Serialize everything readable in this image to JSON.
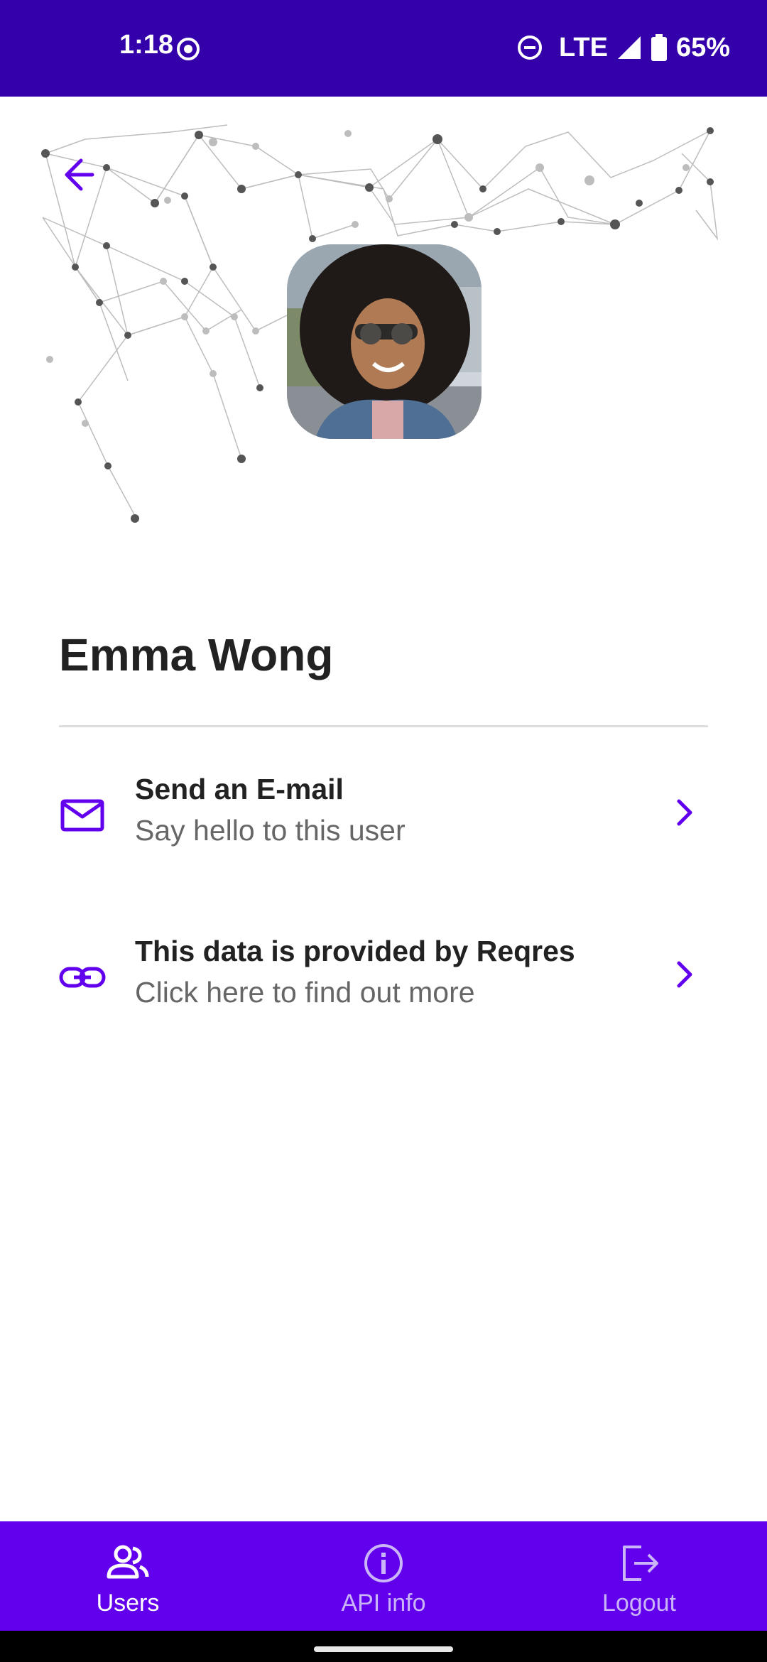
{
  "status_bar": {
    "time": "1:18",
    "network": "LTE",
    "battery": "65%"
  },
  "profile": {
    "name": "Emma Wong",
    "avatar_description": "photo"
  },
  "actions": [
    {
      "title": "Send an E-mail",
      "subtitle": "Say hello to this user",
      "icon": "mail-icon"
    },
    {
      "title": "This data is provided by Reqres",
      "subtitle": "Click here to find out more",
      "icon": "link-icon"
    }
  ],
  "bottom_nav": [
    {
      "label": "Users",
      "icon": "users-icon",
      "active": true
    },
    {
      "label": "API info",
      "icon": "info-icon",
      "active": false
    },
    {
      "label": "Logout",
      "icon": "logout-icon",
      "active": false
    }
  ],
  "colors": {
    "status_bar": "#3300aa",
    "accent": "#6200ee",
    "text_primary": "#222222",
    "text_secondary": "#666666"
  }
}
